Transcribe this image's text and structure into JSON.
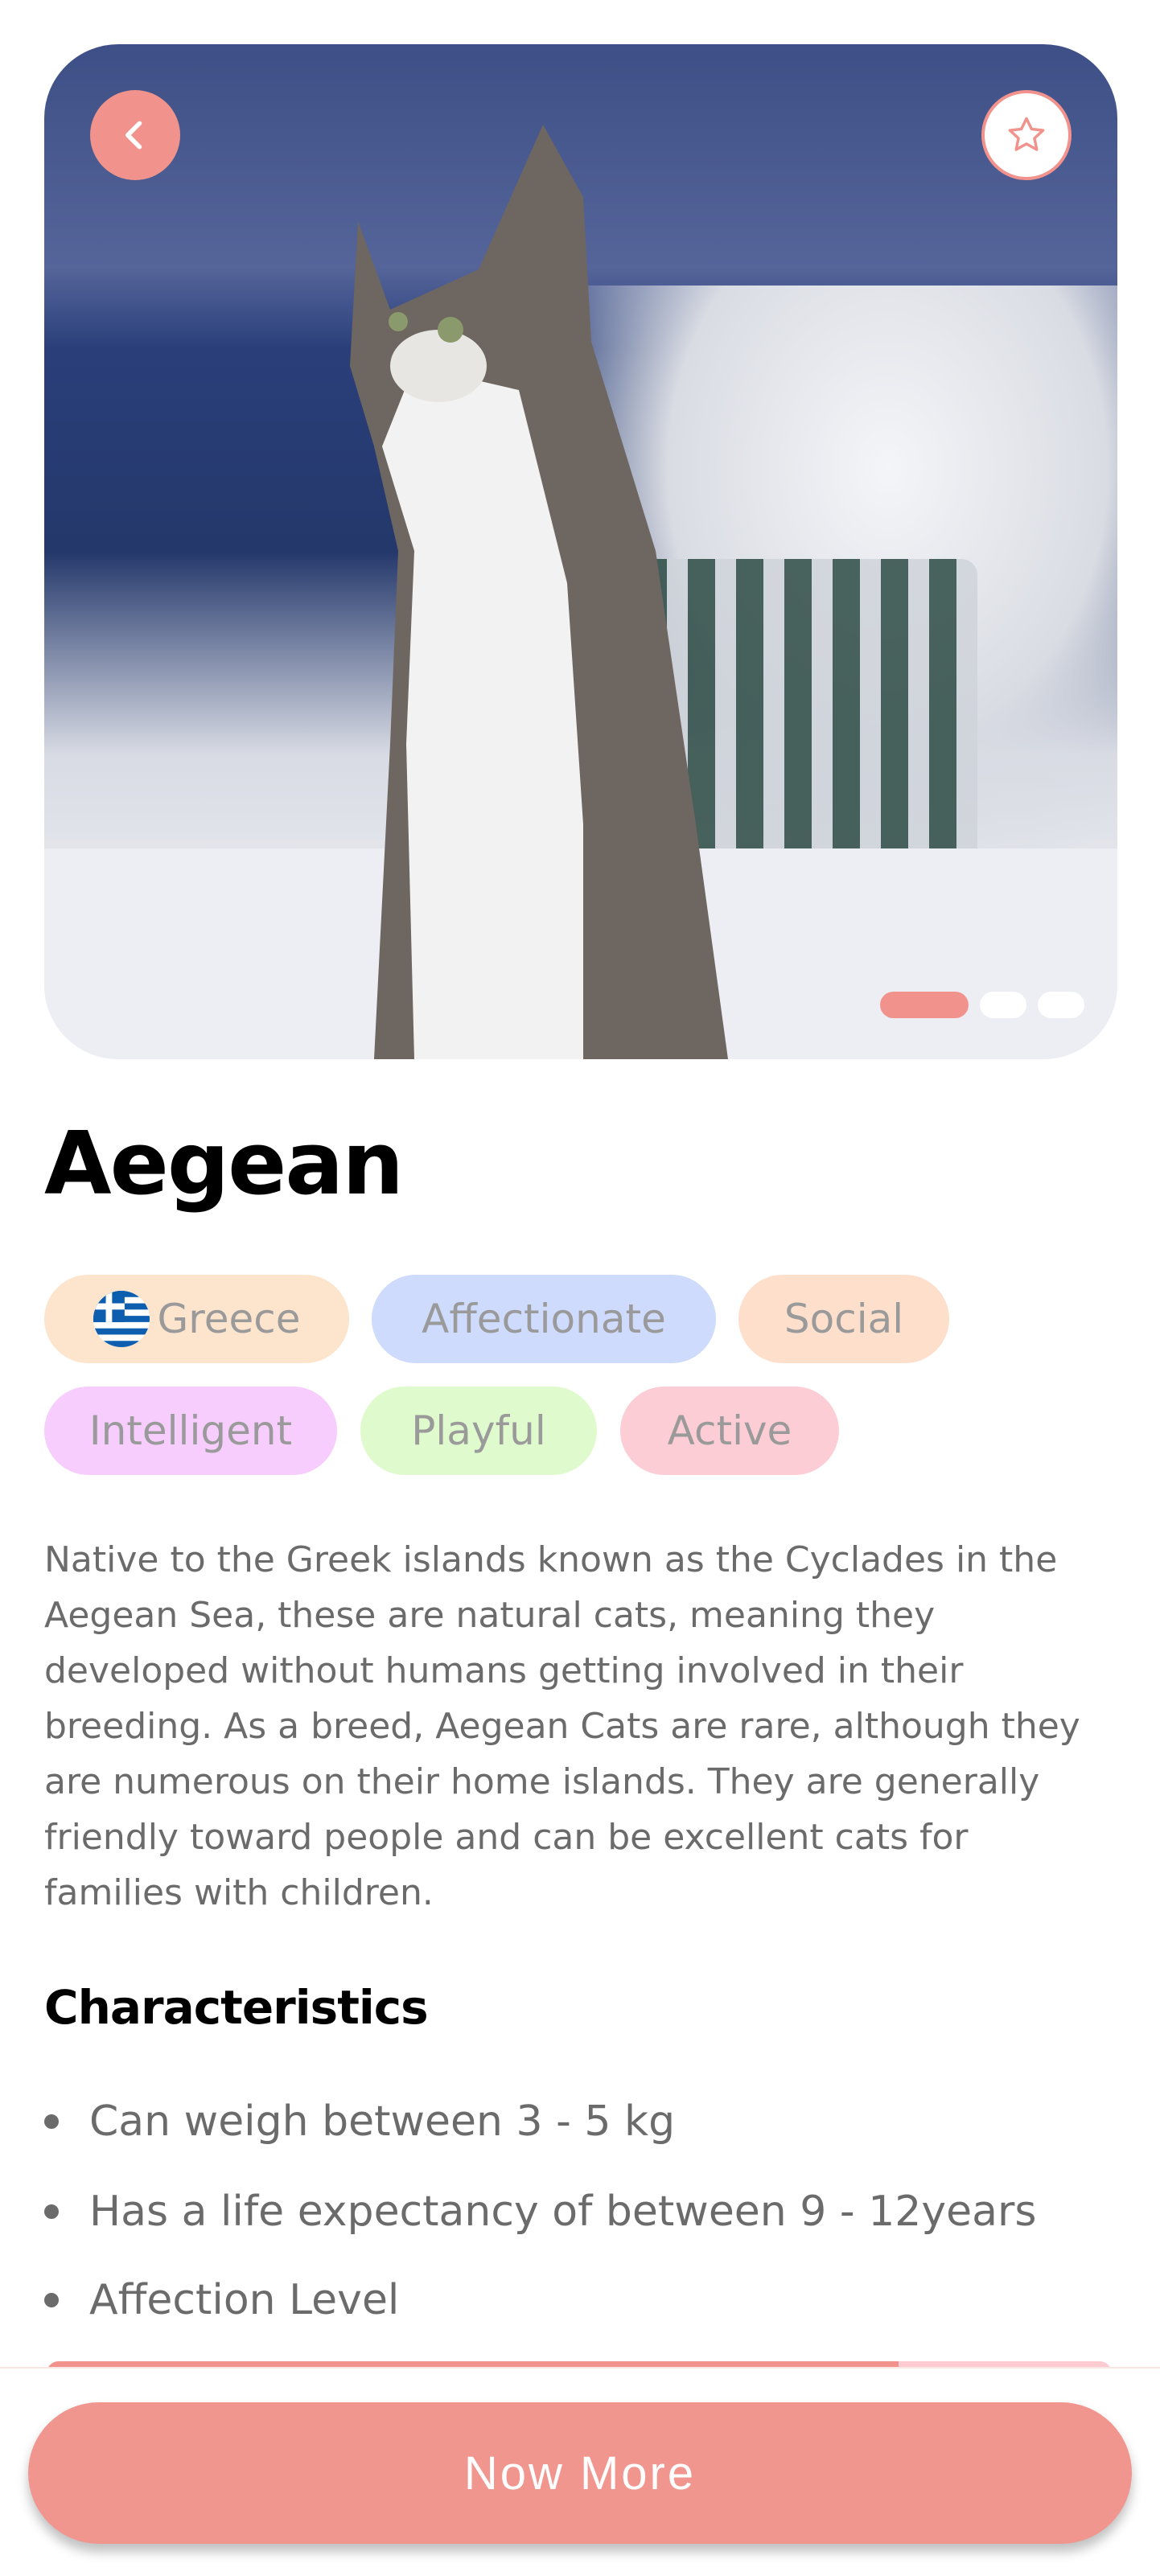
{
  "breed": {
    "name": "Aegean"
  },
  "gallery": {
    "image_count": 3,
    "active_index": 0
  },
  "tags": [
    {
      "label": "Greece",
      "bg": "#fde4cd",
      "flag": "greece-flag"
    },
    {
      "label": "Affectionate",
      "bg": "#cedbfd"
    },
    {
      "label": "Social",
      "bg": "#fddfcc"
    },
    {
      "label": "Intelligent",
      "bg": "#f6cdfd"
    },
    {
      "label": "Playful",
      "bg": "#dffbcd"
    },
    {
      "label": "Active",
      "bg": "#fdcdd6"
    }
  ],
  "description": "Native to the Greek islands known as the Cyclades in the Aegean Sea, these are natural cats, meaning they developed without humans getting involved in their breeding. As a breed, Aegean Cats are rare, although they are numerous on their home islands. They are generally friendly toward people and can be excellent cats for families with children.",
  "characteristics": {
    "title": "Characteristics",
    "items": [
      "Can weigh between 3 - 5 kg",
      "Has a life expectancy of between 9 - 12years",
      "Affection Level"
    ],
    "affection_level_percent": 80
  },
  "cta": {
    "label": "Now More"
  },
  "colors": {
    "accent": "#f1938c",
    "text": "#6b6b6b",
    "tag_text": "#9a9a9a"
  }
}
